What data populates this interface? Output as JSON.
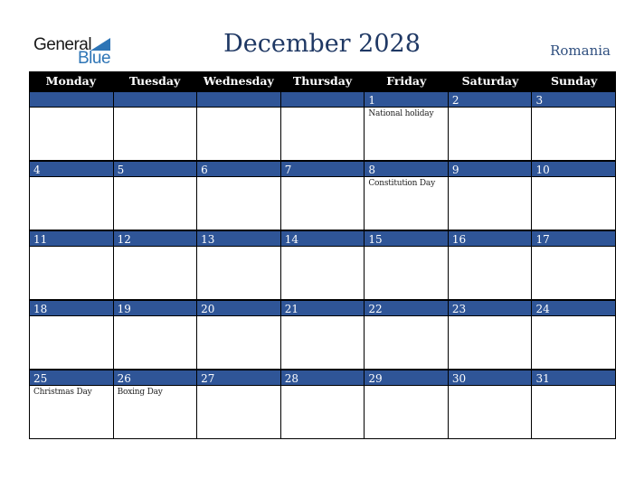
{
  "logo": {
    "line1": "General",
    "line2": "Blue"
  },
  "title": "December 2028",
  "country": "Romania",
  "weekdays": [
    "Monday",
    "Tuesday",
    "Wednesday",
    "Thursday",
    "Friday",
    "Saturday",
    "Sunday"
  ],
  "weeks": [
    [
      {
        "day": "",
        "event": ""
      },
      {
        "day": "",
        "event": ""
      },
      {
        "day": "",
        "event": ""
      },
      {
        "day": "",
        "event": ""
      },
      {
        "day": "1",
        "event": "National holiday"
      },
      {
        "day": "2",
        "event": ""
      },
      {
        "day": "3",
        "event": ""
      }
    ],
    [
      {
        "day": "4",
        "event": ""
      },
      {
        "day": "5",
        "event": ""
      },
      {
        "day": "6",
        "event": ""
      },
      {
        "day": "7",
        "event": ""
      },
      {
        "day": "8",
        "event": "Constitution Day"
      },
      {
        "day": "9",
        "event": ""
      },
      {
        "day": "10",
        "event": ""
      }
    ],
    [
      {
        "day": "11",
        "event": ""
      },
      {
        "day": "12",
        "event": ""
      },
      {
        "day": "13",
        "event": ""
      },
      {
        "day": "14",
        "event": ""
      },
      {
        "day": "15",
        "event": ""
      },
      {
        "day": "16",
        "event": ""
      },
      {
        "day": "17",
        "event": ""
      }
    ],
    [
      {
        "day": "18",
        "event": ""
      },
      {
        "day": "19",
        "event": ""
      },
      {
        "day": "20",
        "event": ""
      },
      {
        "day": "21",
        "event": ""
      },
      {
        "day": "22",
        "event": ""
      },
      {
        "day": "23",
        "event": ""
      },
      {
        "day": "24",
        "event": ""
      }
    ],
    [
      {
        "day": "25",
        "event": "Christmas Day"
      },
      {
        "day": "26",
        "event": "Boxing Day"
      },
      {
        "day": "27",
        "event": ""
      },
      {
        "day": "28",
        "event": ""
      },
      {
        "day": "29",
        "event": ""
      },
      {
        "day": "30",
        "event": ""
      },
      {
        "day": "31",
        "event": ""
      }
    ]
  ]
}
